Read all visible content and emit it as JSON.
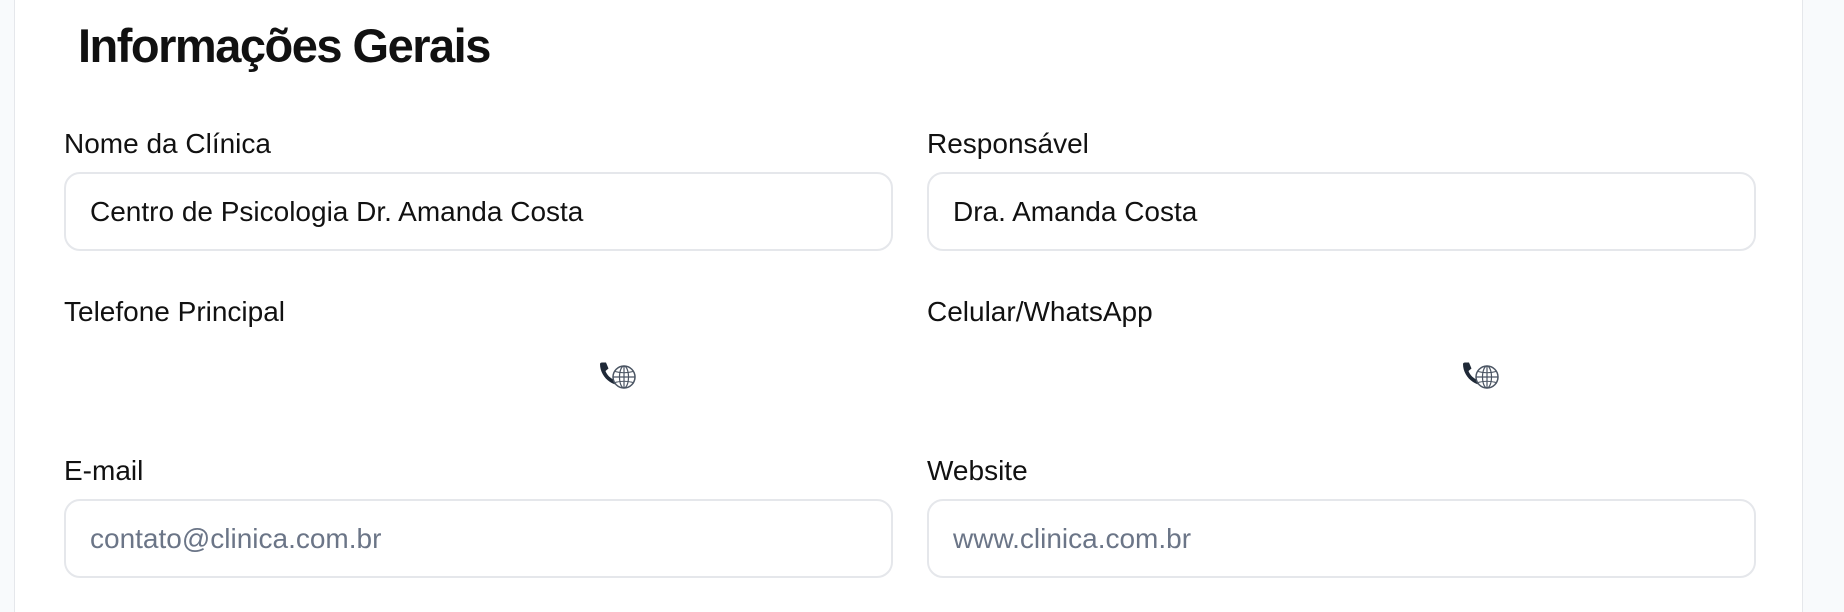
{
  "section": {
    "title": "Informações Gerais"
  },
  "fields": {
    "clinic_name": {
      "label": "Nome da Clínica",
      "value": "Centro de Psicologia Dr. Amanda Costa"
    },
    "responsible": {
      "label": "Responsável",
      "value": "Dra. Amanda Costa"
    },
    "main_phone": {
      "label": "Telefone Principal",
      "icon": "phone-globe-icon"
    },
    "mobile_whatsapp": {
      "label": "Celular/WhatsApp",
      "icon": "phone-globe-icon"
    },
    "email": {
      "label": "E-mail",
      "placeholder": "contato@clinica.com.br"
    },
    "website": {
      "label": "Website",
      "placeholder": "www.clinica.com.br"
    }
  },
  "colors": {
    "label_text": "#111111",
    "input_border": "#e5e7eb",
    "placeholder_text": "#6b7587"
  }
}
